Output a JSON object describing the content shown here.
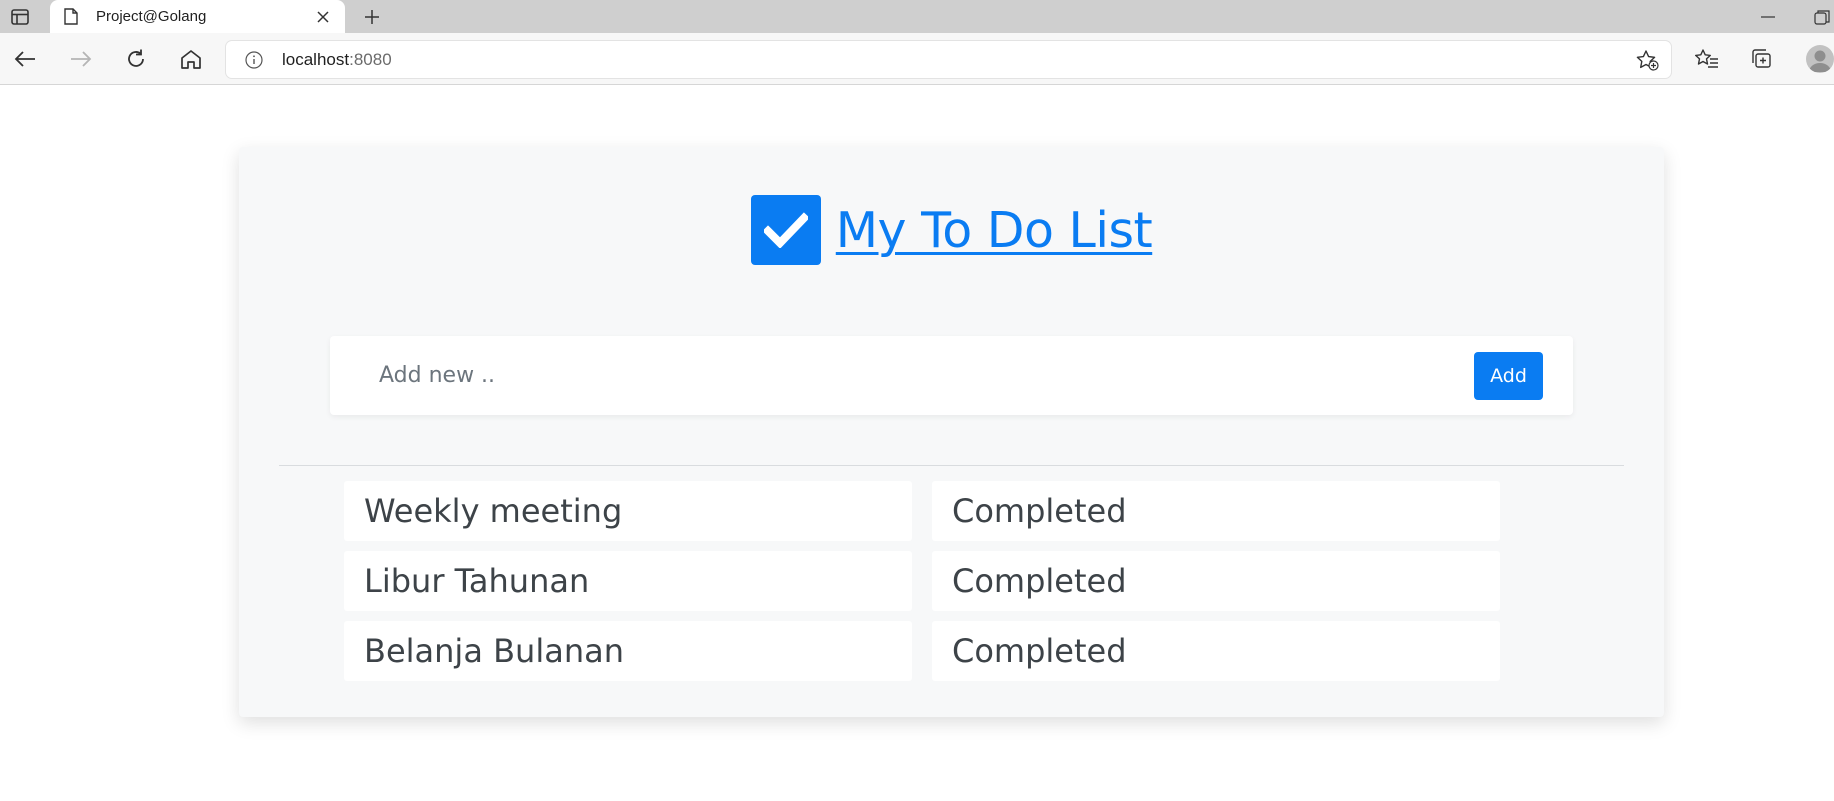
{
  "browser": {
    "tab_title": "Project@Golang",
    "url_host": "localhost",
    "url_port": ":8080"
  },
  "page": {
    "title": "My To Do List",
    "add_form": {
      "placeholder": "Add new ..",
      "value": "",
      "button_label": "Add"
    },
    "todos": [
      {
        "task": "Weekly meeting",
        "status": "Completed"
      },
      {
        "task": "Libur Tahunan",
        "status": "Completed"
      },
      {
        "task": "Belanja Bulanan",
        "status": "Completed"
      }
    ]
  },
  "colors": {
    "accent": "#0a7cf2",
    "card_bg": "#f7f8f9",
    "text": "#3d4348"
  }
}
